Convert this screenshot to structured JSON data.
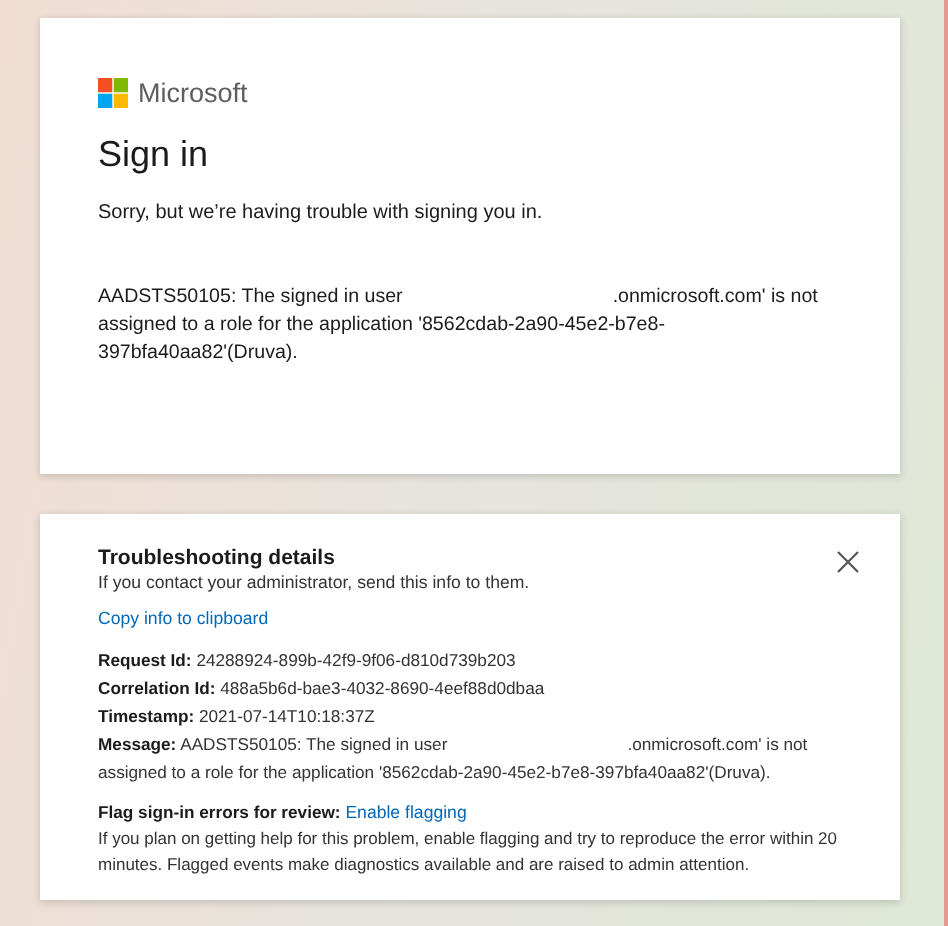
{
  "brand": {
    "name": "Microsoft"
  },
  "signin": {
    "title": "Sign in",
    "subtitle": "Sorry, but we’re having trouble with signing you in.",
    "error_before": "AADSTS50105: The signed in user",
    "error_after": ".onmicrosoft.com' is not assigned to a role for the application '8562cdab-2a90-45e2-b7e8-397bfa40aa82'(Druva)."
  },
  "troubleshooting": {
    "title": "Troubleshooting details",
    "intro": "If you contact your administrator, send this info to them.",
    "copy_link": "Copy info to clipboard",
    "details": [
      {
        "label": "Request Id:",
        "value": "24288924-899b-42f9-9f06-d810d739b203"
      },
      {
        "label": "Correlation Id:",
        "value": "488a5b6d-bae3-4032-8690-4eef88d0dbaa"
      },
      {
        "label": "Timestamp:",
        "value": "2021-07-14T10:18:37Z"
      },
      {
        "label": "Message:",
        "value": "AADSTS50105: The signed in user",
        "value_after": ".onmicrosoft.com' is not assigned to a role for the application '8562cdab-2a90-45e2-b7e8-397bfa40aa82'(Druva)."
      }
    ],
    "flag_label": "Flag sign-in errors for review:",
    "flag_link": "Enable flagging",
    "flag_text": "If you plan on getting help for this problem, enable flagging and try to reproduce the error within 20 minutes. Flagged events make diagnostics available and are raised to admin attention."
  }
}
